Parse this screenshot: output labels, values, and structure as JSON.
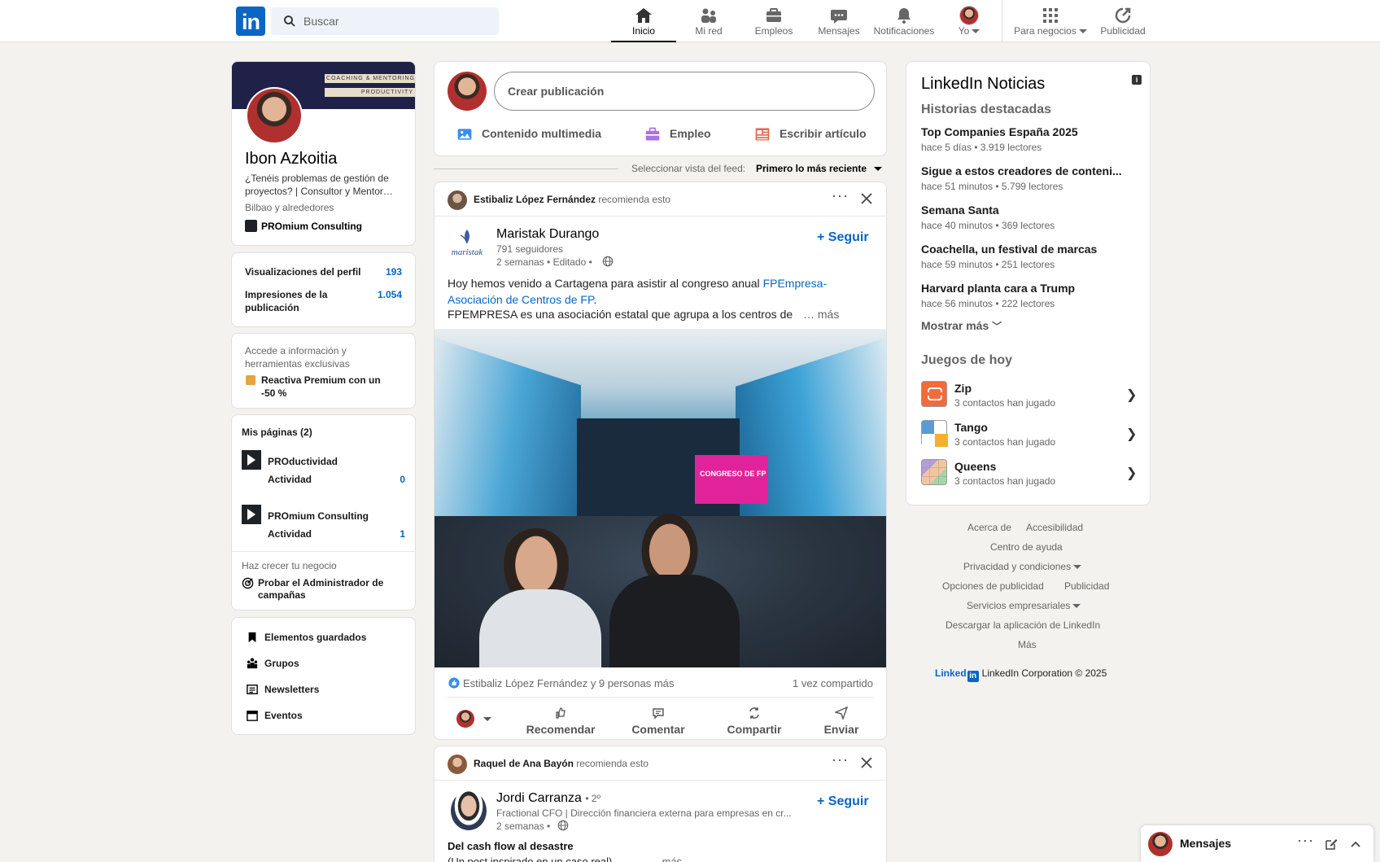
{
  "nav": {
    "search_placeholder": "Buscar",
    "items": [
      {
        "label": "Inicio"
      },
      {
        "label": "Mi red"
      },
      {
        "label": "Empleos"
      },
      {
        "label": "Mensajes"
      },
      {
        "label": "Notificaciones"
      },
      {
        "label": "Yo"
      },
      {
        "label": "Para negocios"
      },
      {
        "label": "Publicidad"
      }
    ]
  },
  "profile": {
    "banner_line1": "COACHING & MENTORING",
    "banner_line2": "PRODUCTIVITY",
    "name": "Ibon Azkoitia",
    "headline": "¿Tenéis problemas de gestión de proyectos? | Consultor y Mentor…",
    "location": "Bilbao y alrededores",
    "company": "PROmium Consulting"
  },
  "stats": {
    "views_label": "Visualizaciones del perfil",
    "views_value": "193",
    "impressions_label_1": "Impresiones de la",
    "impressions_label_2": "publicación",
    "impressions_value": "1.054"
  },
  "premium": {
    "text_1": "Accede a información y",
    "text_2": "herramientas exclusivas",
    "cta_1": "Reactiva Premium con un",
    "cta_2": "-50 %"
  },
  "pages": {
    "title": "Mis páginas (2)",
    "items": [
      {
        "name": "PROductividad",
        "activity_label": "Actividad",
        "activity_value": "0"
      },
      {
        "name": "PROmium Consulting",
        "activity_label": "Actividad",
        "activity_value": "1"
      }
    ],
    "grow_label": "Haz crecer tu negocio",
    "campaign_1": "Probar el Administrador de",
    "campaign_2": "campañas"
  },
  "shortcuts": [
    {
      "label": "Elementos guardados"
    },
    {
      "label": "Grupos"
    },
    {
      "label": "Newsletters"
    },
    {
      "label": "Eventos"
    }
  ],
  "composer": {
    "placeholder": "Crear publicación",
    "media": "Contenido multimedia",
    "job": "Empleo",
    "article": "Escribir artículo"
  },
  "feed_sort": {
    "label": "Seleccionar vista del feed:",
    "value": "Primero lo más reciente"
  },
  "post1": {
    "recommender": "Estibaliz López Fernández",
    "recommends": "recomienda esto",
    "author": "Maristak Durango",
    "logo_text": "maristak",
    "followers": "791 seguidores",
    "time": "2 semanas • Editado •",
    "follow": "Seguir",
    "text_1": "Hoy hemos venido a Cartagena para asistir al congreso anual ",
    "text_link_1": "FPEmpresa-",
    "text_link_2": "Asociación de Centros de FP",
    "text_end": ".",
    "text_2": "FPEMPRESA es una asociación estatal que agrupa a los centros de",
    "more": "… más",
    "screen_text": "CONGRESO DE FP",
    "reactions": "Estibaliz López Fernández y 9 personas más",
    "shares": "1 vez compartido",
    "actions": [
      "Recomendar",
      "Comentar",
      "Compartir",
      "Enviar"
    ]
  },
  "post2": {
    "recommender": "Raquel de Ana Bayón",
    "recommends": "recomienda esto",
    "author": "Jordi Carranza",
    "degree": "• 2º",
    "headline": "Fractional CFO | Dirección financiera externa para empresas en cr...",
    "time": "2 semanas •",
    "follow": "Seguir",
    "title": "Del cash flow al desastre",
    "snippet": "(Un post inspirado en un caso real)",
    "more": "… más"
  },
  "news": {
    "title": "LinkedIn Noticias",
    "subtitle": "Historias destacadas",
    "items": [
      {
        "title": "Top Companies España 2025",
        "meta": "hace 5 días • 3.919 lectores"
      },
      {
        "title": "Sigue a estos creadores de conteni...",
        "meta": "hace 51 minutos • 5.799 lectores"
      },
      {
        "title": "Semana Santa",
        "meta": "hace 40 minutos • 369 lectores"
      },
      {
        "title": "Coachella, un festival de marcas",
        "meta": "hace 59 minutos • 251 lectores"
      },
      {
        "title": "Harvard planta cara a Trump",
        "meta": "hace 56 minutos • 222 lectores"
      }
    ],
    "show_more": "Mostrar más",
    "games_title": "Juegos de hoy",
    "games": [
      {
        "name": "Zip",
        "meta": "3 contactos han jugado"
      },
      {
        "name": "Tango",
        "meta": "3 contactos han jugado"
      },
      {
        "name": "Queens",
        "meta": "3 contactos han jugado"
      }
    ]
  },
  "footer": {
    "about": "Acerca de",
    "accessibility": "Accesibilidad",
    "help": "Centro de ayuda",
    "privacy": "Privacidad y condiciones",
    "ad_options": "Opciones de publicidad",
    "advertising": "Publicidad",
    "business": "Servicios empresariales",
    "download": "Descargar la aplicación de LinkedIn",
    "more": "Más",
    "brand": "Linked",
    "copyright": "LinkedIn Corporation © 2025"
  },
  "messaging": {
    "label": "Mensajes"
  }
}
